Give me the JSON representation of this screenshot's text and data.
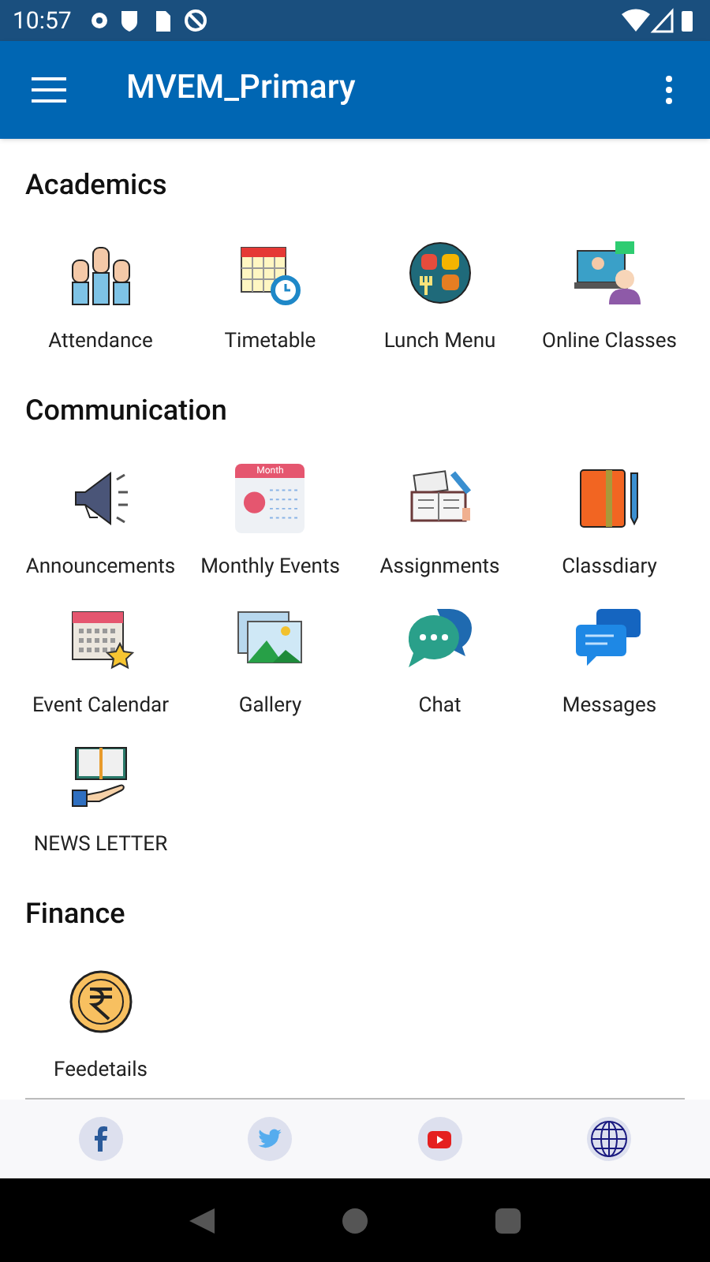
{
  "status_bar": {
    "time": "10:57"
  },
  "app_bar": {
    "title": "MVEM_Primary"
  },
  "sections": [
    {
      "title": "Academics",
      "items": [
        {
          "label": "Attendance"
        },
        {
          "label": "Timetable"
        },
        {
          "label": "Lunch Menu"
        },
        {
          "label": "Online Classes"
        }
      ]
    },
    {
      "title": "Communication",
      "items": [
        {
          "label": "Announcements"
        },
        {
          "label": "Monthly Events"
        },
        {
          "label": "Assignments"
        },
        {
          "label": "Classdiary"
        },
        {
          "label": "Event Calendar"
        },
        {
          "label": "Gallery"
        },
        {
          "label": "Chat"
        },
        {
          "label": "Messages"
        },
        {
          "label": "NEWS LETTER"
        }
      ]
    },
    {
      "title": "Finance",
      "items": [
        {
          "label": "Feedetails"
        }
      ]
    }
  ],
  "month_badge": "Month"
}
